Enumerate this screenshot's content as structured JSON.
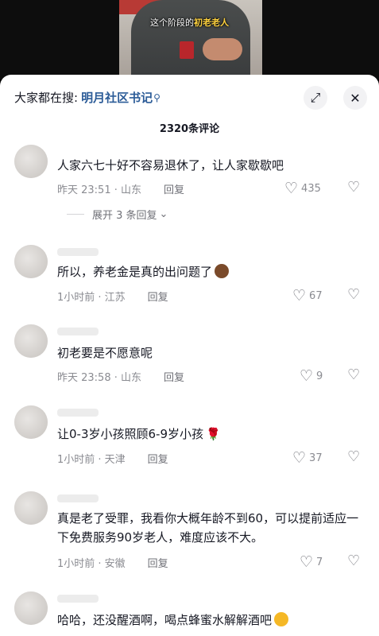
{
  "video": {
    "caption_prefix": "这个阶段的",
    "caption_highlight": "初老老人"
  },
  "header": {
    "search_prefix": "大家都在搜:",
    "search_keyword": "明月社区书记",
    "count_label": "2320条评论"
  },
  "comments": [
    {
      "text": "人家六七十好不容易退休了，让人家歇歇吧",
      "time_location": "昨天 23:51 · 山东",
      "reply_label": "回复",
      "likes": "435",
      "expand_label": "展开 3 条回复"
    },
    {
      "text": "所以，养老金是真的出问题了",
      "time_location": "1小时前 · 江苏",
      "reply_label": "回复",
      "likes": "67",
      "emoji": "poop-emoji"
    },
    {
      "text": "初老要是不愿意呢",
      "time_location": "昨天 23:58 · 山东",
      "reply_label": "回复",
      "likes": "9"
    },
    {
      "text": "让0-3岁小孩照顾6-9岁小孩",
      "time_location": "1小时前 · 天津",
      "reply_label": "回复",
      "likes": "37",
      "emoji": "rose-emoji"
    },
    {
      "text": "真是老了受罪，我看你大概年龄不到60，可以提前适应一下免费服务90岁老人，难度应该不大。",
      "time_location": "1小时前 · 安徽",
      "reply_label": "回复",
      "likes": "7"
    },
    {
      "text": "哈哈，还没醒酒啊，喝点蜂蜜水解解酒吧",
      "emoji": "laughing-tears-emoji"
    }
  ],
  "colors": {
    "keyword": "#2c5c98",
    "caption_highlight": "#ffd23f"
  }
}
